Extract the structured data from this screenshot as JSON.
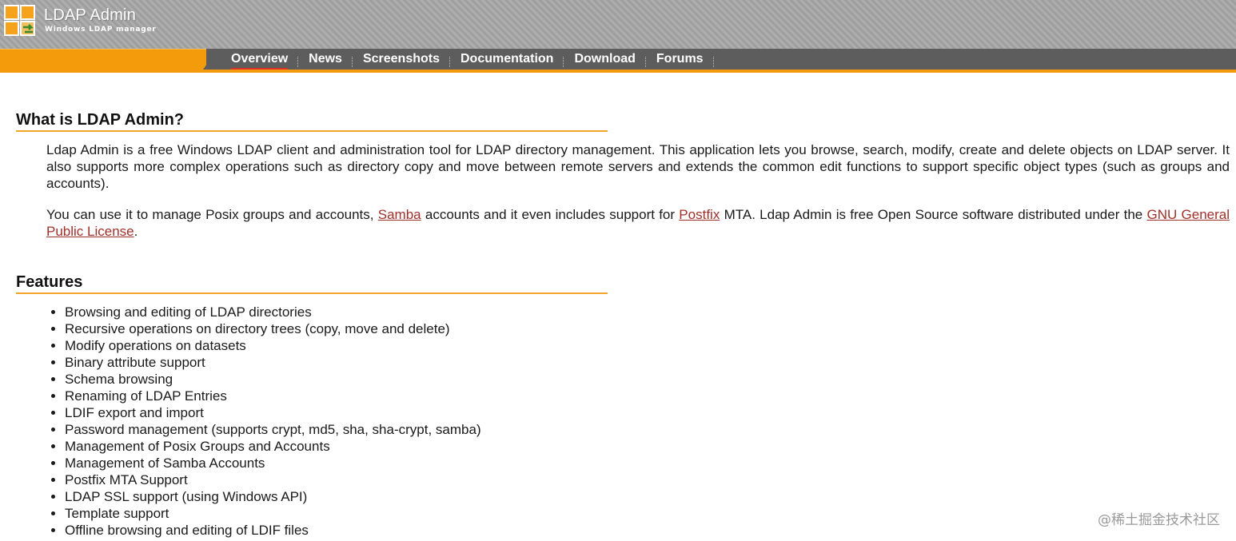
{
  "header": {
    "app_title": "LDAP Admin",
    "app_subtitle": "Windows LDAP manager",
    "logo_icon": "ldap-admin-logo-icon",
    "brand_orange": "#f49b0c",
    "nav_dark": "#5d5d5d"
  },
  "nav": {
    "items": [
      {
        "label": "Overview",
        "active": true
      },
      {
        "label": "News",
        "active": false
      },
      {
        "label": "Screenshots",
        "active": false
      },
      {
        "label": "Documentation",
        "active": false
      },
      {
        "label": "Download",
        "active": false
      },
      {
        "label": "Forums",
        "active": false
      }
    ]
  },
  "intro": {
    "heading": "What is LDAP Admin?",
    "paragraph1": "Ldap Admin is a free Windows LDAP client and administration tool for LDAP directory management. This application lets you browse, search, modify, create and delete objects on LDAP server. It also supports more complex operations such as directory copy and move between remote servers and extends the common edit functions to support specific object types (such as groups and accounts).",
    "paragraph2": {
      "part1": "You can use it to manage Posix groups and accounts, ",
      "link_samba": "Samba",
      "part2": " accounts and it even includes support for ",
      "link_postfix": "Postfix",
      "part3": " MTA. Ldap Admin is free Open Source software distributed under the ",
      "link_gpl": "GNU General Public License",
      "part4": "."
    },
    "link_color": "#a0302a"
  },
  "features": {
    "heading": "Features",
    "items": [
      "Browsing and editing of LDAP directories",
      "Recursive operations on directory trees (copy, move and delete)",
      "Modify operations on datasets",
      "Binary attribute support",
      "Schema browsing",
      "Renaming of LDAP Entries",
      "LDIF export and import",
      "Password management (supports crypt, md5, sha, sha-crypt, samba)",
      "Management of Posix Groups and Accounts",
      "Management of Samba Accounts",
      "Postfix MTA Support",
      "LDAP SSL support (using Windows API)",
      "Template support",
      "Offline browsing and editing of LDIF files"
    ]
  },
  "watermark": "@稀土掘金技术社区"
}
